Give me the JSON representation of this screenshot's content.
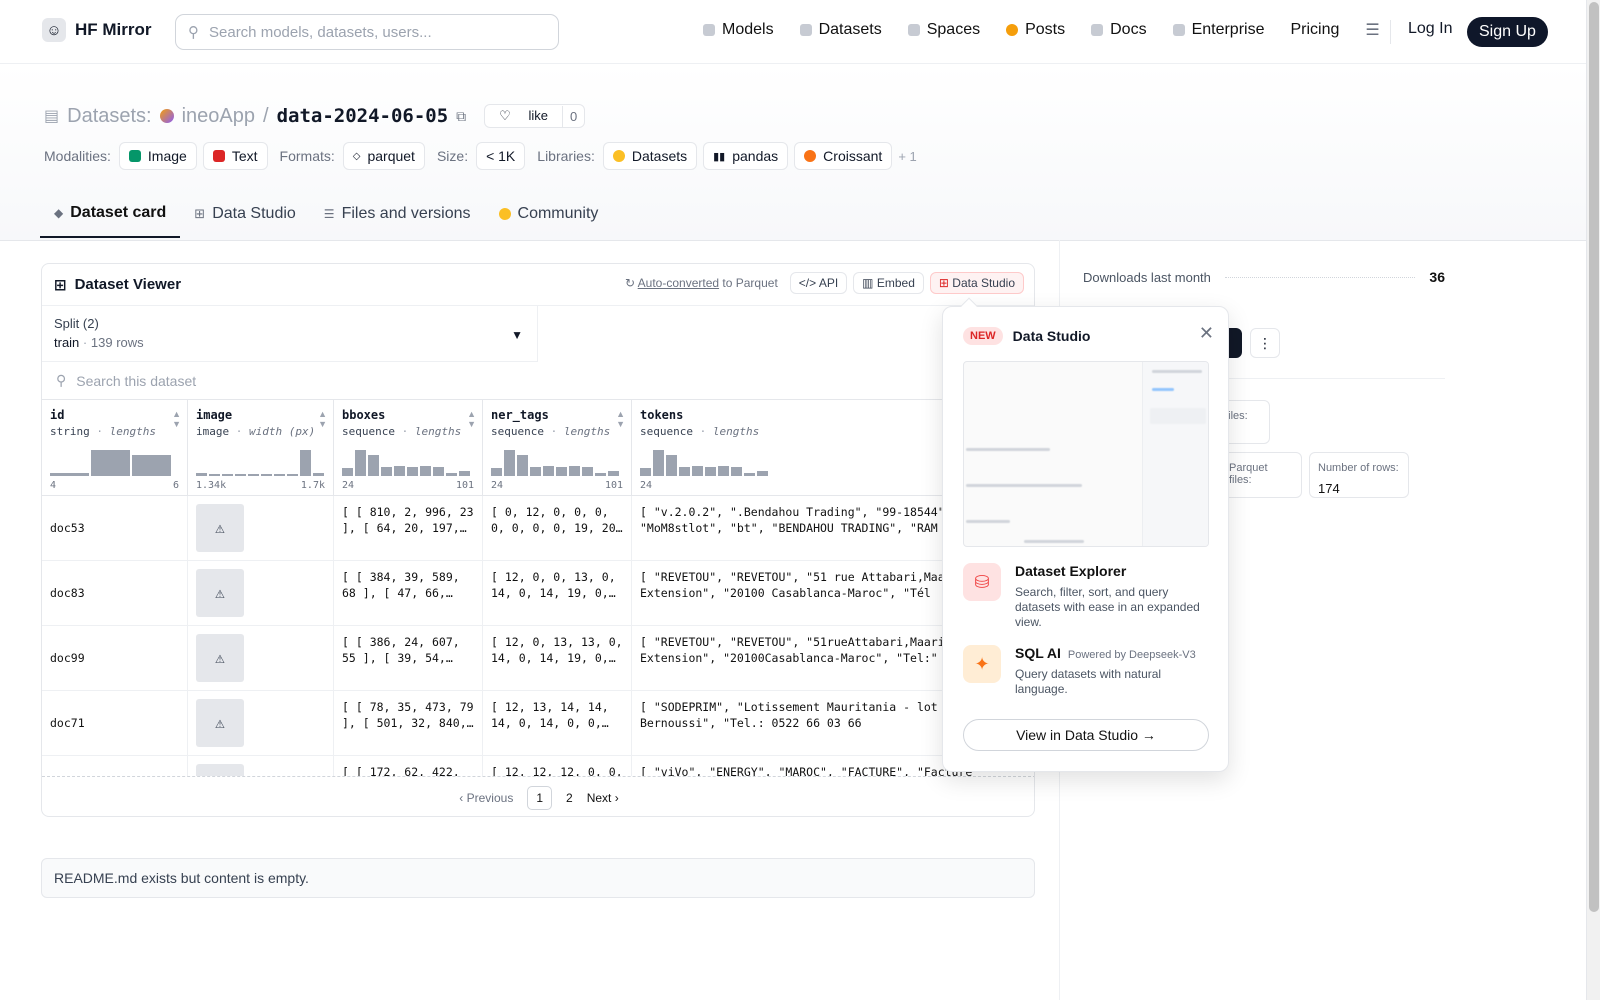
{
  "nav": {
    "logo": "HF Mirror",
    "search_placeholder": "Search models, datasets, users...",
    "links": [
      "Models",
      "Datasets",
      "Spaces",
      "Posts",
      "Docs",
      "Enterprise",
      "Pricing"
    ],
    "login": "Log In",
    "signup": "Sign Up"
  },
  "header": {
    "prefix": "Datasets:",
    "owner": "ineoApp",
    "sep": "/",
    "name": "data-2024-06-05",
    "like": "like",
    "like_count": "0",
    "modalities_label": "Modalities:",
    "modalities": [
      "Image",
      "Text"
    ],
    "formats_label": "Formats:",
    "format": "parquet",
    "size_label": "Size:",
    "size": "< 1K",
    "libraries_label": "Libraries:",
    "libraries": [
      "Datasets",
      "pandas",
      "Croissant"
    ],
    "more": "+ 1"
  },
  "tabs": [
    "Dataset card",
    "Data Studio",
    "Files and versions",
    "Community"
  ],
  "viewer": {
    "title": "Dataset Viewer",
    "autoconv_link": "Auto-converted",
    "autoconv_rest": "to Parquet",
    "api": "API",
    "embed": "Embed",
    "studio": "Data Studio",
    "split_label": "Split (2)",
    "split_name": "train",
    "split_dot": "·",
    "split_rows": "139 rows",
    "search_placeholder": "Search this dataset",
    "columns": [
      {
        "name": "id",
        "type": "string",
        "sub": "lengths",
        "min": "4",
        "max": "6",
        "hist": [
          0.1,
          1,
          0.8
        ]
      },
      {
        "name": "image",
        "type": "image",
        "sub": "width (px)",
        "min": "1.34k",
        "max": "1.7k",
        "hist": [
          0.1,
          0,
          0,
          0,
          0,
          0,
          0,
          0,
          1,
          0.1
        ]
      },
      {
        "name": "bboxes",
        "type": "sequence",
        "sub": "lengths",
        "min": "24",
        "max": "101",
        "hist": [
          0.3,
          1,
          0.8,
          0.35,
          0.4,
          0.35,
          0.4,
          0.35,
          0.1,
          0.2
        ]
      },
      {
        "name": "ner_tags",
        "type": "sequence",
        "sub": "lengths",
        "min": "24",
        "max": "101",
        "hist": [
          0.3,
          1,
          0.8,
          0.35,
          0.4,
          0.35,
          0.4,
          0.35,
          0.1,
          0.2
        ]
      },
      {
        "name": "tokens",
        "type": "sequence",
        "sub": "lengths",
        "min": "24",
        "max": "101",
        "hist": [
          0.3,
          1,
          0.8,
          0.35,
          0.4,
          0.35,
          0.4,
          0.35,
          0.1,
          0.2
        ]
      }
    ],
    "rows": [
      {
        "id": "doc53",
        "bboxes": "[ [ 810, 2, 996, 23 ], [ 64, 20, 197,…",
        "ner_tags": "[ 0, 12, 0, 0, 0, 0, 0, 0, 0, 19, 20…",
        "tokens": "[ \"v.2.0.2\", \".Bendahou Trading\", \"99-18544\", \"MoM8stlot\", \"bt\", \"BENDAHOU TRADING\", \"RAM"
      },
      {
        "id": "doc83",
        "bboxes": "[ [ 384, 39, 589, 68 ], [ 47, 66,…",
        "ner_tags": "[ 12, 0, 0, 13, 0, 14, 0, 14, 19, 0,…",
        "tokens": "[ \"REVETOU\", \"REVETOU\", \"51 rue Attabari,Maarif Extension\", \"20100 Casablanca-Maroc\", \"Tél"
      },
      {
        "id": "doc99",
        "bboxes": "[ [ 386, 24, 607, 55 ], [ 39, 54,…",
        "ner_tags": "[ 12, 0, 13, 13, 0, 14, 0, 14, 19, 0,…",
        "tokens": "[ \"REVETOU\", \"REVETOU\", \"51rueAttabari,Maarif Extension\", \"20100Casablanca-Maroc\", \"Tel:\""
      },
      {
        "id": "doc71",
        "bboxes": "[ [ 78, 35, 473, 79 ], [ 501, 32, 840,…",
        "ner_tags": "[ 12, 13, 14, 14, 14, 0, 14, 0, 0,…",
        "tokens": "[ \"SODEPRIM\", \"Lotissement Mauritania - lot Z.I. Sidi Bernoussi\", \"Tel.: 0522 66 03 66"
      },
      {
        "id": "",
        "bboxes": "[ [ 172, 62, 422,",
        "ner_tags": "[ 12, 12, 12, 0, 0,",
        "tokens": "[ \"viVo\", \"ENERGY\", \"MAROC\", \"FACTURE\", \"Facture"
      }
    ],
    "pager": {
      "prev": "Previous",
      "p1": "1",
      "p2": "2",
      "next": "Next"
    }
  },
  "readme": "README.md exists but content is empty.",
  "sidebar": {
    "downloads_label": "Downloads last month",
    "downloads": "36",
    "files_label_partial": "t files:",
    "parquet_label": "Parquet files:",
    "rows_label": "Number of rows:",
    "rows_value": "174"
  },
  "popup": {
    "badge": "NEW",
    "title": "Data Studio",
    "explorer_title": "Dataset Explorer",
    "explorer_desc": "Search, filter, sort, and query datasets with ease in an expanded view.",
    "sql_title": "SQL AI",
    "sql_powered": "Powered by Deepseek-V3",
    "sql_desc": "Query datasets with natural language.",
    "button": "View in Data Studio →"
  },
  "colors": {
    "accent": "#111827",
    "red": "#dc2626",
    "orange": "#f97316"
  }
}
